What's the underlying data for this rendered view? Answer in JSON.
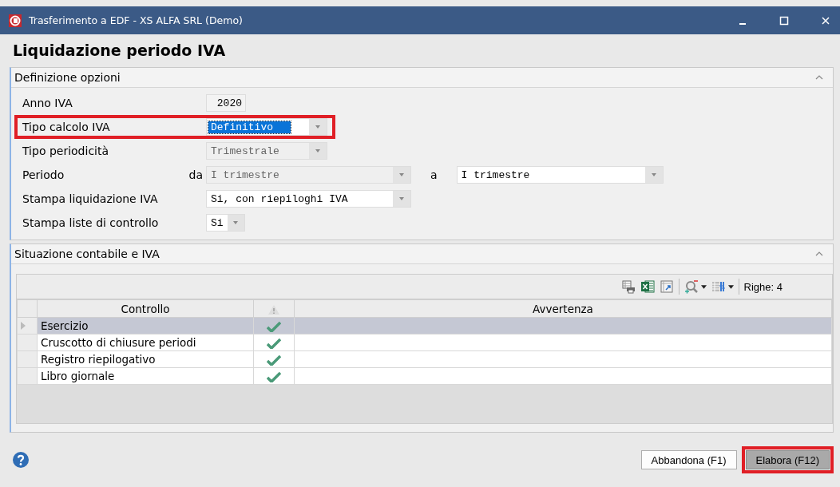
{
  "window": {
    "title": "Trasferimento a EDF - XS ALFA SRL  (Demo)"
  },
  "heading": "Liquidazione periodo IVA",
  "options_panel": {
    "title": "Definizione opzioni",
    "expanded": true,
    "fields": [
      {
        "kind": "text",
        "label": "Anno IVA",
        "value": "2020",
        "focused": false,
        "disabled": false
      },
      {
        "kind": "dropdown",
        "label": "Tipo calcolo IVA",
        "value": "Definitivo",
        "highlighted": true,
        "focused": true,
        "disabled": false
      },
      {
        "kind": "dropdown",
        "label": "Tipo periodicità",
        "value": "Trimestrale",
        "focused": false,
        "disabled": true
      },
      {
        "kind": "range",
        "label": "Periodo",
        "from_label": "da",
        "value": "I trimestre",
        "to_label": "a",
        "to_value": "I trimestre",
        "focused": false,
        "disabled": true
      },
      {
        "kind": "dropdown",
        "label": "Stampa liquidazione IVA",
        "value": "Si, con riepiloghi IVA",
        "focused": false,
        "disabled": false
      },
      {
        "kind": "dropdown",
        "label": "Stampa liste di controllo",
        "value": "Si",
        "focused": false,
        "disabled": false
      }
    ]
  },
  "status_panel": {
    "title": "Situazione contabile e IVA",
    "expanded": true,
    "row_count": "Righe: 4",
    "table": {
      "columns": [
        "Controllo",
        "Avvertenza"
      ],
      "rows": [
        {
          "controllo": "Esercizio",
          "ok": true,
          "selected": true
        },
        {
          "controllo": "Cruscotto di chiusure periodi",
          "ok": true,
          "selected": false
        },
        {
          "controllo": "Registro riepilogativo",
          "ok": true,
          "selected": false
        },
        {
          "controllo": "Libro giornale",
          "ok": true,
          "selected": false
        }
      ]
    }
  },
  "buttons": [
    {
      "label": "Abbandona (F1)",
      "highlighted": false
    },
    {
      "label": "Elabora (F12)",
      "highlighted": true
    }
  ]
}
